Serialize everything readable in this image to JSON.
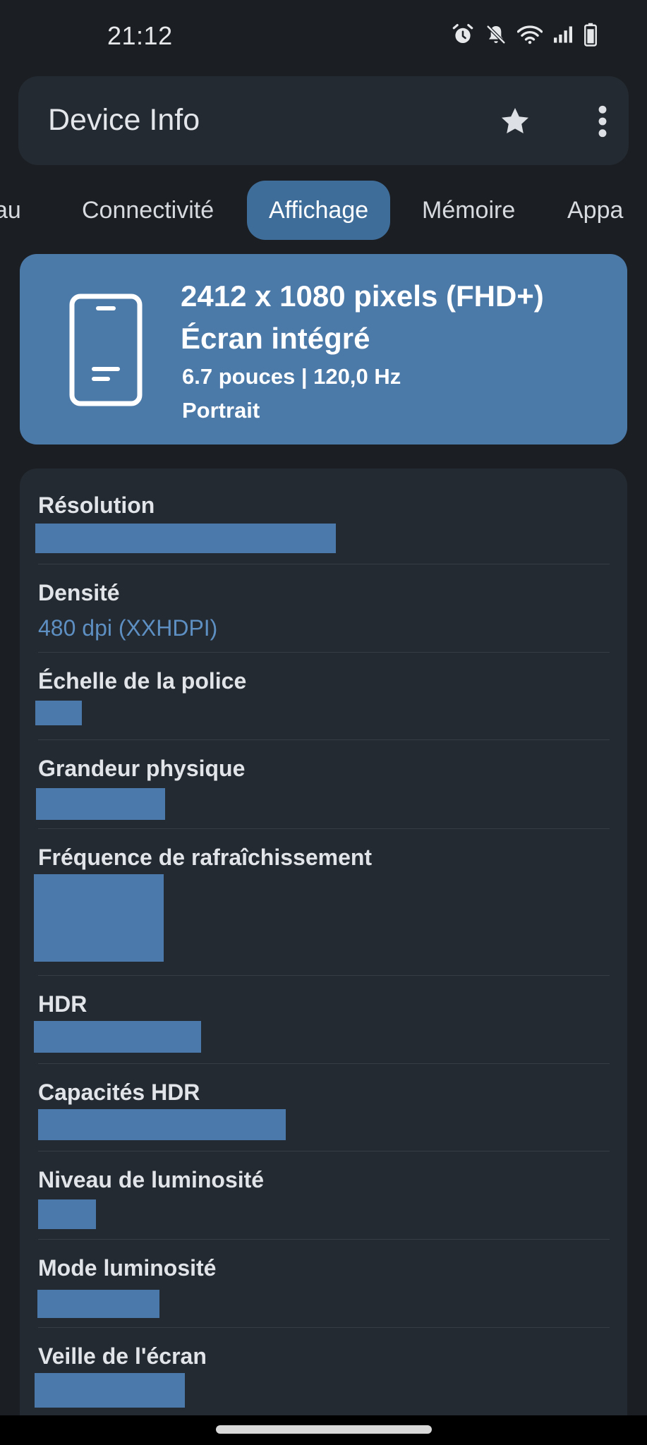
{
  "status_bar": {
    "time": "21:12",
    "icons": [
      "alarm-icon",
      "notifications-off-icon",
      "wifi-icon",
      "signal-icon",
      "battery-icon"
    ]
  },
  "app_bar": {
    "title": "Device Info",
    "actions": [
      "star-icon",
      "more-vert-icon"
    ]
  },
  "tabs": [
    {
      "label": "au",
      "active": false
    },
    {
      "label": "Connectivité",
      "active": false
    },
    {
      "label": "Affichage",
      "active": true
    },
    {
      "label": "Mémoire",
      "active": false
    },
    {
      "label": "Appa",
      "active": false
    }
  ],
  "summary": {
    "icon": "phone-icon",
    "resolution": "2412 x 1080 pixels (FHD+)",
    "screen_type": "Écran intégré",
    "size_refresh": "6.7 pouces | 120,0 Hz",
    "orientation": "Portrait"
  },
  "details": [
    {
      "label": "Résolution",
      "value": null
    },
    {
      "label": "Densité",
      "value": "480 dpi (XXHDPI)"
    },
    {
      "label": "Échelle de la police",
      "value": null
    },
    {
      "label": "Grandeur physique",
      "value": null
    },
    {
      "label": "Fréquence de rafraîchissement",
      "value": null
    },
    {
      "label": "HDR",
      "value": null
    },
    {
      "label": "Capacités HDR",
      "value": null
    },
    {
      "label": "Niveau de luminosité",
      "value": null
    },
    {
      "label": "Mode luminosité",
      "value": null
    },
    {
      "label": "Veille de l'écran",
      "value": null
    }
  ],
  "colors": {
    "background": "#1b1f24",
    "card": "#242a31",
    "accent": "#4b79a8",
    "active_tab": "#3f6d99",
    "value_text": "#5d8fc2"
  }
}
